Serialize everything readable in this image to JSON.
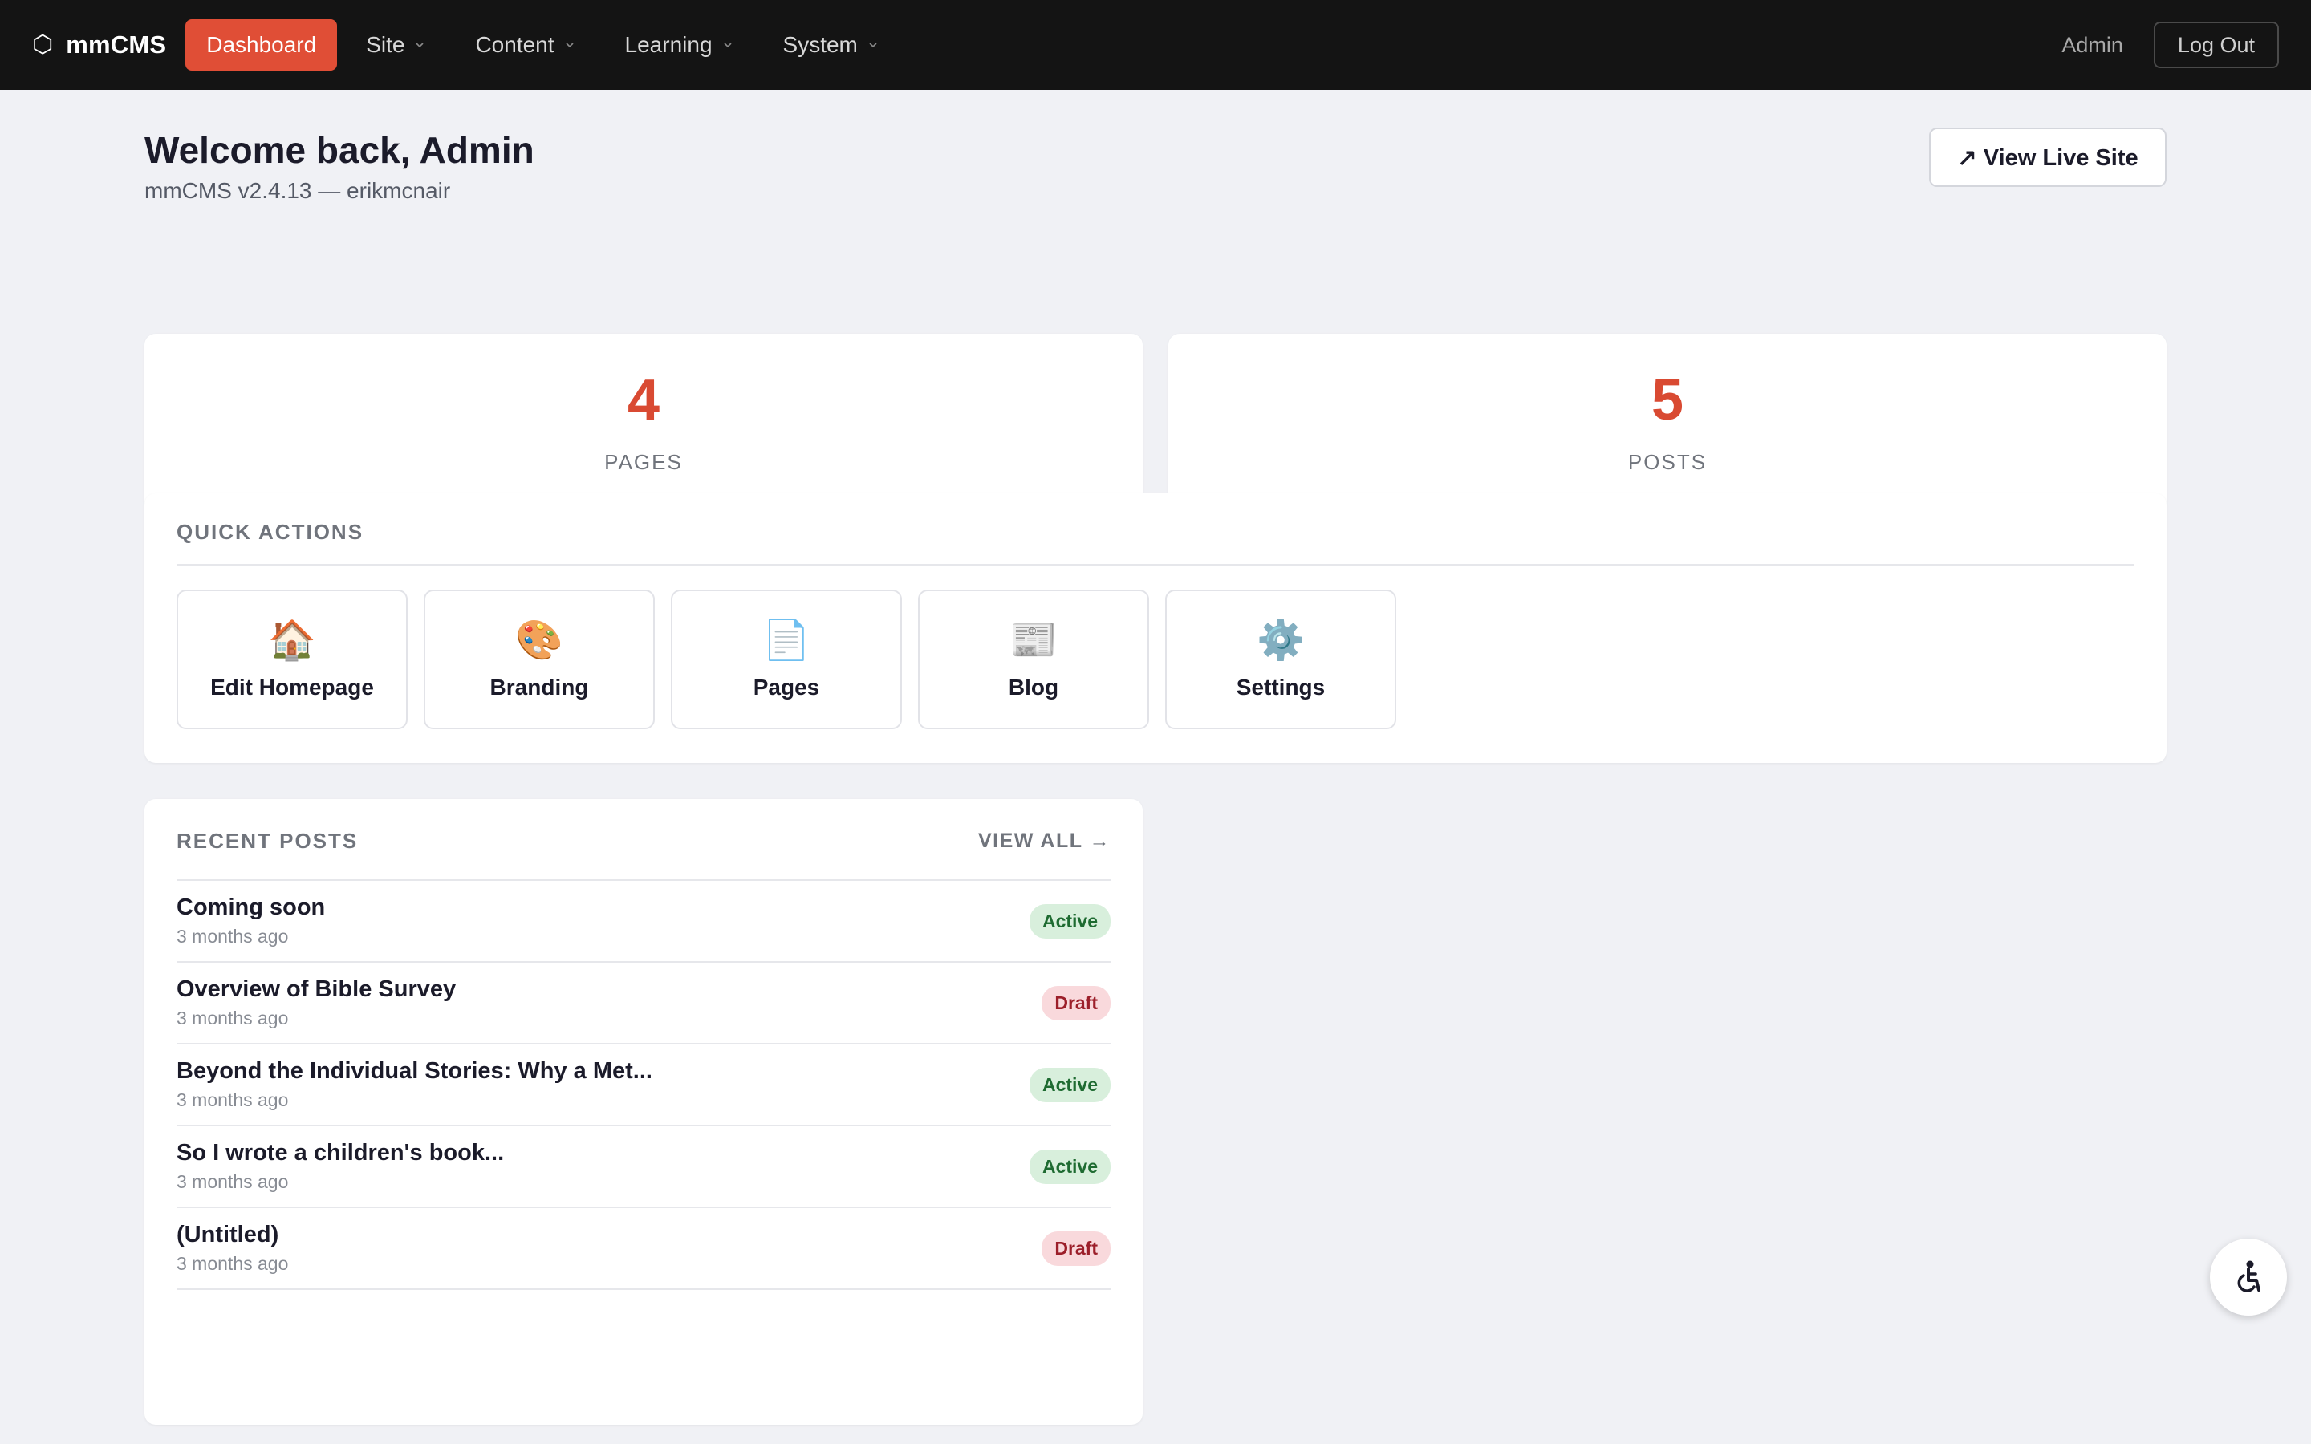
{
  "nav": {
    "brand_icon": "⬡",
    "brand": "mmCMS",
    "items": [
      {
        "label": "Dashboard",
        "active": true
      },
      {
        "label": "Site",
        "dropdown": true
      },
      {
        "label": "Content",
        "dropdown": true
      },
      {
        "label": "Learning",
        "dropdown": true
      },
      {
        "label": "System",
        "dropdown": true
      }
    ],
    "user": "Admin",
    "logout": "Log Out"
  },
  "header": {
    "title": "Welcome back, Admin",
    "subtitle": "mmCMS v2.4.13 — erikmcnair",
    "live_button": "↗ View Live Site"
  },
  "stats": [
    {
      "value": "4",
      "label": "PAGES"
    },
    {
      "value": "5",
      "label": "POSTS"
    }
  ],
  "quick_actions": {
    "title": "QUICK ACTIONS",
    "items": [
      {
        "icon": "🏠",
        "icon_name": "house-icon",
        "label": "Edit Homepage"
      },
      {
        "icon": "🎨",
        "icon_name": "palette-icon",
        "label": "Branding"
      },
      {
        "icon": "📄",
        "icon_name": "page-icon",
        "label": "Pages"
      },
      {
        "icon": "📰",
        "icon_name": "newspaper-icon",
        "label": "Blog"
      },
      {
        "icon": "⚙️",
        "icon_name": "gear-icon",
        "label": "Settings"
      }
    ]
  },
  "recent_posts": {
    "title": "RECENT POSTS",
    "view_all": "VIEW ALL →",
    "items": [
      {
        "title": "Coming soon",
        "time": "3 months ago",
        "status": "Active"
      },
      {
        "title": "Overview of Bible Survey",
        "time": "3 months ago",
        "status": "Draft"
      },
      {
        "title": "Beyond the Individual Stories: Why a Met...",
        "time": "3 months ago",
        "status": "Active"
      },
      {
        "title": "So I wrote a children's book...",
        "time": "3 months ago",
        "status": "Active"
      },
      {
        "title": "(Untitled)",
        "time": "3 months ago",
        "status": "Draft"
      }
    ]
  },
  "colors": {
    "accent": "#e04e36",
    "stat_number": "#d94a32",
    "topbar": "#141414",
    "background": "#f0f1f5",
    "badge_active_bg": "#d8efdc",
    "badge_draft_bg": "#f9d9dc"
  }
}
